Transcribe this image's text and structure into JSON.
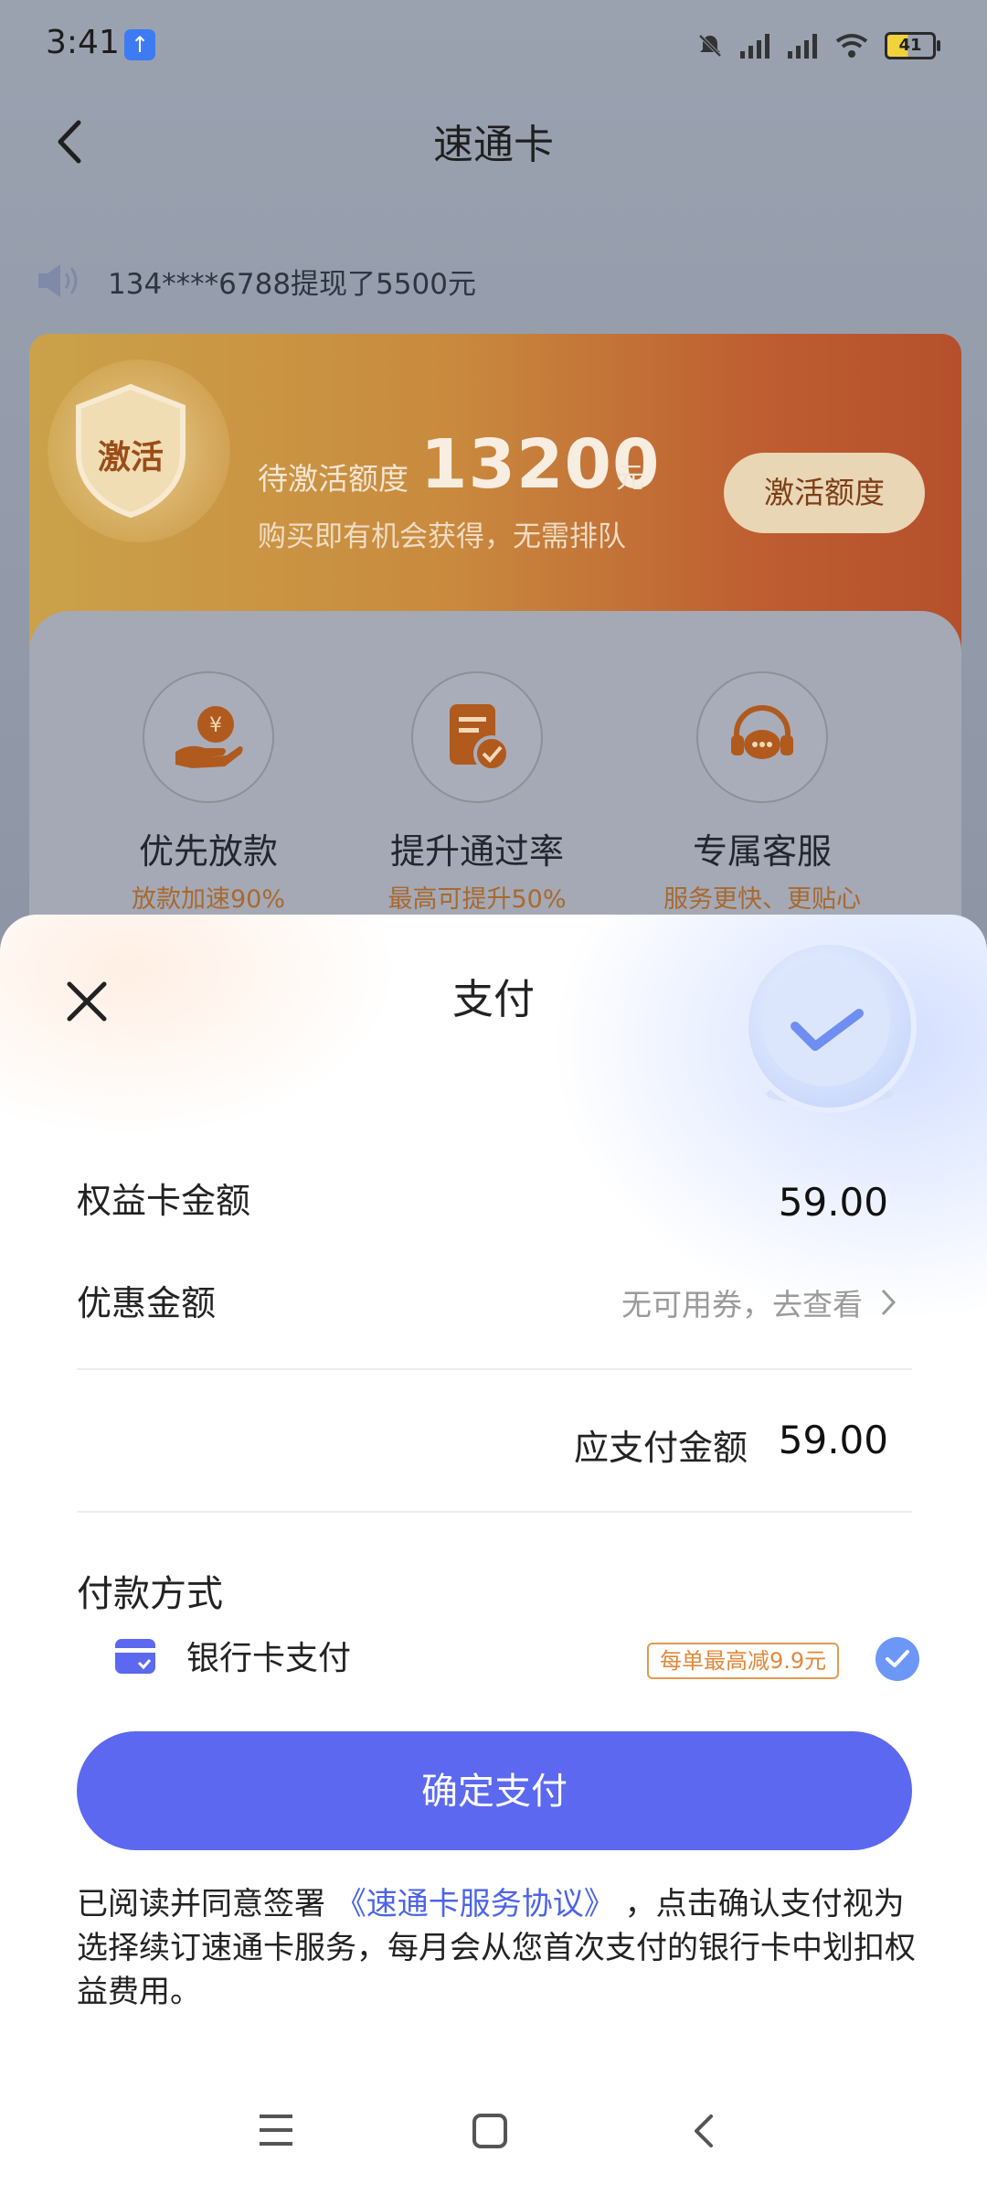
{
  "status_bar": {
    "time": "3:41",
    "battery": "41",
    "icons": [
      "upload-icon",
      "mute-bell-icon",
      "signal-icon",
      "signal-icon",
      "wifi-icon",
      "battery-icon"
    ]
  },
  "header": {
    "title": "速通卡"
  },
  "notice": {
    "text": "134****6788提现了5500元"
  },
  "promo": {
    "shield_text": "激活",
    "quota_label": "待激活额度",
    "quota_value": "13200",
    "quota_unit": "元",
    "subtitle": "购买即有机会获得，无需排队",
    "button_label": "激活额度"
  },
  "benefits": [
    {
      "title": "优先放款",
      "subtitle": "放款加速90%",
      "icon": "money-hand-icon"
    },
    {
      "title": "提升通过率",
      "subtitle": "最高可提升50%",
      "icon": "document-check-icon"
    },
    {
      "title": "专属客服",
      "subtitle": "服务更快、更贴心",
      "icon": "headset-icon"
    }
  ],
  "payment_sheet": {
    "title": "支付",
    "card_amount_label": "权益卡金额",
    "card_amount": "59.00",
    "discount_label": "优惠金额",
    "discount_value": "无可用券，去查看",
    "due_label": "应支付金额",
    "due_amount": "59.00",
    "method_title": "付款方式",
    "method": {
      "label": "银行卡支付",
      "tag": "每单最高减9.9元",
      "selected": true
    },
    "confirm_label": "确定支付",
    "agreement": {
      "prefix": "已阅读并同意签署",
      "link": "《速通卡服务协议》",
      "suffix": "，点击确认支付视为选择续订速通卡服务，每月会从您首次支付的银行卡中划扣权益费用。"
    }
  },
  "colors": {
    "primary_button": "#5b68ef",
    "link": "#4c64e6",
    "tag_orange": "#e0883a",
    "promo_gradient_start": "#caa24a",
    "promo_gradient_end": "#b5502c"
  },
  "system_nav": [
    "menu-icon",
    "home-icon",
    "back-icon"
  ]
}
